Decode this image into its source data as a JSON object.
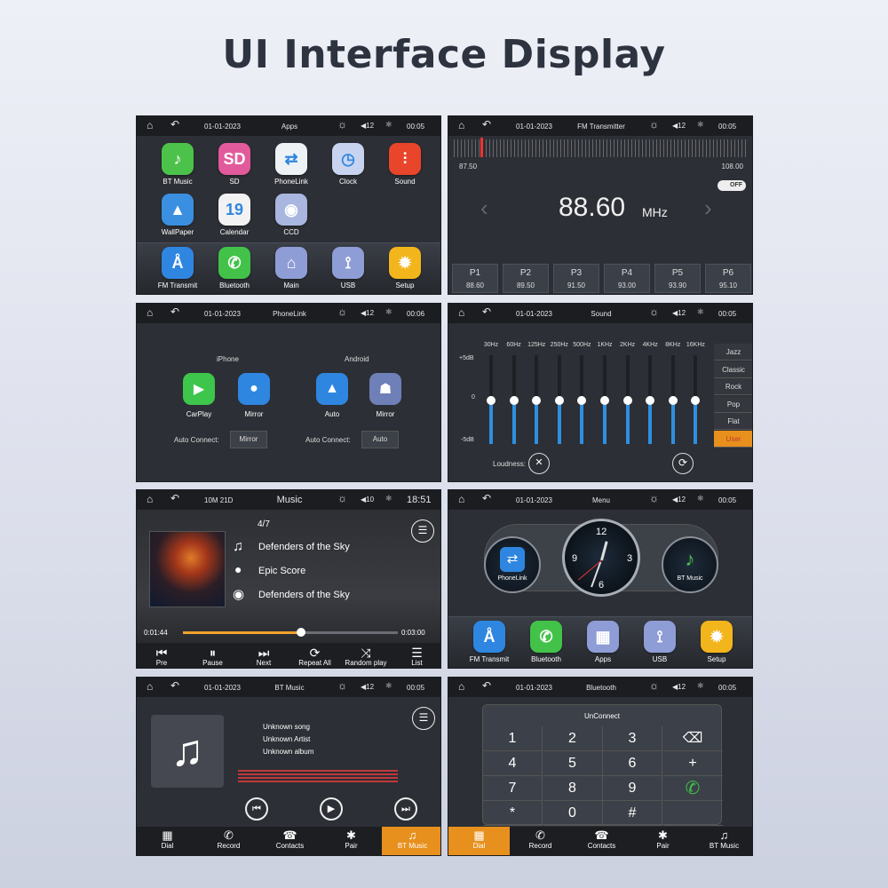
{
  "page_title": "UI Interface Display",
  "status": {
    "date": "01-01-2023",
    "volume": "12",
    "time": "00:05",
    "home_glyph": "⌂",
    "back_glyph": "↶",
    "bright_glyph": "☼",
    "bt_glyph": "✱"
  },
  "apps_screen": {
    "title": "Apps",
    "time": "00:05",
    "apps": [
      {
        "label": "BT Music",
        "icon": "music-note-icon",
        "glyph": "♪",
        "color": "#4cc24a"
      },
      {
        "label": "SD",
        "icon": "sd-card-icon",
        "glyph": "SD",
        "color": "#e25a9b"
      },
      {
        "label": "PhoneLink",
        "icon": "phonelink-icon",
        "glyph": "⇄",
        "color": "#eef2f5"
      },
      {
        "label": "Clock",
        "icon": "clock-icon",
        "glyph": "◷",
        "color": "#c8d4ef"
      },
      {
        "label": "Sound",
        "icon": "equalizer-icon",
        "glyph": "⫶",
        "color": "#e8452b"
      },
      {
        "label": "WallPaper",
        "icon": "wallpaper-icon",
        "glyph": "▲",
        "color": "#3b8fe0"
      },
      {
        "label": "Calendar",
        "icon": "calendar-icon",
        "glyph": "19",
        "color": "#f2f2f2"
      },
      {
        "label": "CCD",
        "icon": "camera-icon",
        "glyph": "◉",
        "color": "#a9b6e0"
      }
    ],
    "dock": [
      {
        "label": "FM Transmit",
        "icon": "antenna-icon",
        "glyph": "Å",
        "color": "#2f86e0"
      },
      {
        "label": "Bluetooth",
        "icon": "phone-icon",
        "glyph": "✆",
        "color": "#43c24a"
      },
      {
        "label": "Main",
        "icon": "home-icon",
        "glyph": "⌂",
        "color": "#8f9dd6"
      },
      {
        "label": "USB",
        "icon": "usb-icon",
        "glyph": "⟟",
        "color": "#8f9dd6"
      },
      {
        "label": "Setup",
        "icon": "gear-icon",
        "glyph": "✹",
        "color": "#f3b51c"
      }
    ]
  },
  "fm_screen": {
    "title": "FM Transmitter",
    "time": "00:05",
    "range_min": "87.50",
    "range_max": "108.00",
    "frequency": "88.60",
    "unit": "MHz",
    "toggle": "OFF",
    "presets": [
      {
        "name": "P1",
        "freq": "88.60"
      },
      {
        "name": "P2",
        "freq": "89.50"
      },
      {
        "name": "P3",
        "freq": "91.50"
      },
      {
        "name": "P4",
        "freq": "93.00"
      },
      {
        "name": "P5",
        "freq": "93.90"
      },
      {
        "name": "P6",
        "freq": "95.10"
      }
    ]
  },
  "phonelink_screen": {
    "title": "PhoneLink",
    "time": "00:06",
    "iphone_label": "iPhone",
    "android_label": "Android",
    "carplay": "CarPlay",
    "mirror_ios": "Mirror",
    "auto": "Auto",
    "mirror_android": "Mirror",
    "auto_connect_label": "Auto Connect:",
    "ios_auto_value": "Mirror",
    "android_auto_value": "Auto"
  },
  "sound_screen": {
    "title": "Sound",
    "time": "00:05",
    "bands": [
      "30Hz",
      "60Hz",
      "125Hz",
      "250Hz",
      "500Hz",
      "1KHz",
      "2KHz",
      "4KHz",
      "8KHz",
      "16KHz"
    ],
    "scale_top": "+5dB",
    "scale_mid": "0",
    "scale_bottom": "-5dB",
    "presets": [
      "Jazz",
      "Classic",
      "Rock",
      "Pop",
      "Flat",
      "User"
    ],
    "active_preset": "User",
    "loudness_label": "Loudness:"
  },
  "music_screen": {
    "title": "Music",
    "date": "10M 21D",
    "volume": "10",
    "time": "18:51",
    "track_index": "4/7",
    "song": "Defenders of the Sky",
    "artist": "Epic Score",
    "album": "Defenders of the Sky",
    "elapsed": "0:01:44",
    "duration": "0:03:00",
    "progress": 0.55,
    "controls": [
      "Pre",
      "Pause",
      "Next",
      "Repeat All",
      "Random play",
      "List"
    ],
    "control_glyphs": [
      "⏮",
      "⏸",
      "⏭",
      "⟳",
      "⤨",
      "☰"
    ]
  },
  "menu_screen": {
    "title": "Menu",
    "time": "00:05",
    "left_gauge": "PhoneLink",
    "right_gauge": "BT Music",
    "clock_numbers": [
      "12",
      "3",
      "6",
      "9"
    ],
    "dock": [
      {
        "label": "FM Transmit",
        "glyph": "Å",
        "color": "#2f86e0"
      },
      {
        "label": "Bluetooth",
        "glyph": "✆",
        "color": "#43c24a"
      },
      {
        "label": "Apps",
        "glyph": "▦",
        "color": "#8f9dd6"
      },
      {
        "label": "USB",
        "glyph": "⟟",
        "color": "#8f9dd6"
      },
      {
        "label": "Setup",
        "glyph": "✹",
        "color": "#f3b51c"
      }
    ]
  },
  "btmusic_screen": {
    "title": "BT Music",
    "time": "00:05",
    "song": "Unknown song",
    "artist": "Unknown Artist",
    "album": "Unknown album",
    "tabs": [
      "Dial",
      "Record",
      "Contacts",
      "Pair",
      "BT Music"
    ],
    "tab_glyphs": [
      "▦",
      "✆",
      "☎",
      "✱",
      "♫"
    ],
    "active_tab": "BT Music"
  },
  "dial_screen": {
    "title": "Bluetooth",
    "time": "00:05",
    "status": "UnConnect",
    "keys": [
      "1",
      "2",
      "3",
      "⌫",
      "4",
      "5",
      "6",
      "+",
      "7",
      "8",
      "9",
      "✆",
      "*",
      "0",
      "#",
      ""
    ],
    "tabs": [
      "Dial",
      "Record",
      "Contacts",
      "Pair",
      "BT Music"
    ],
    "tab_glyphs": [
      "▦",
      "✆",
      "☎",
      "✱",
      "♫"
    ],
    "active_tab": "Dial"
  },
  "colors": {
    "accent": "#e8901d",
    "eq_blue": "#2f8fe0",
    "screen_bg": "#2c2f35",
    "status_bg": "#1b1d21"
  }
}
